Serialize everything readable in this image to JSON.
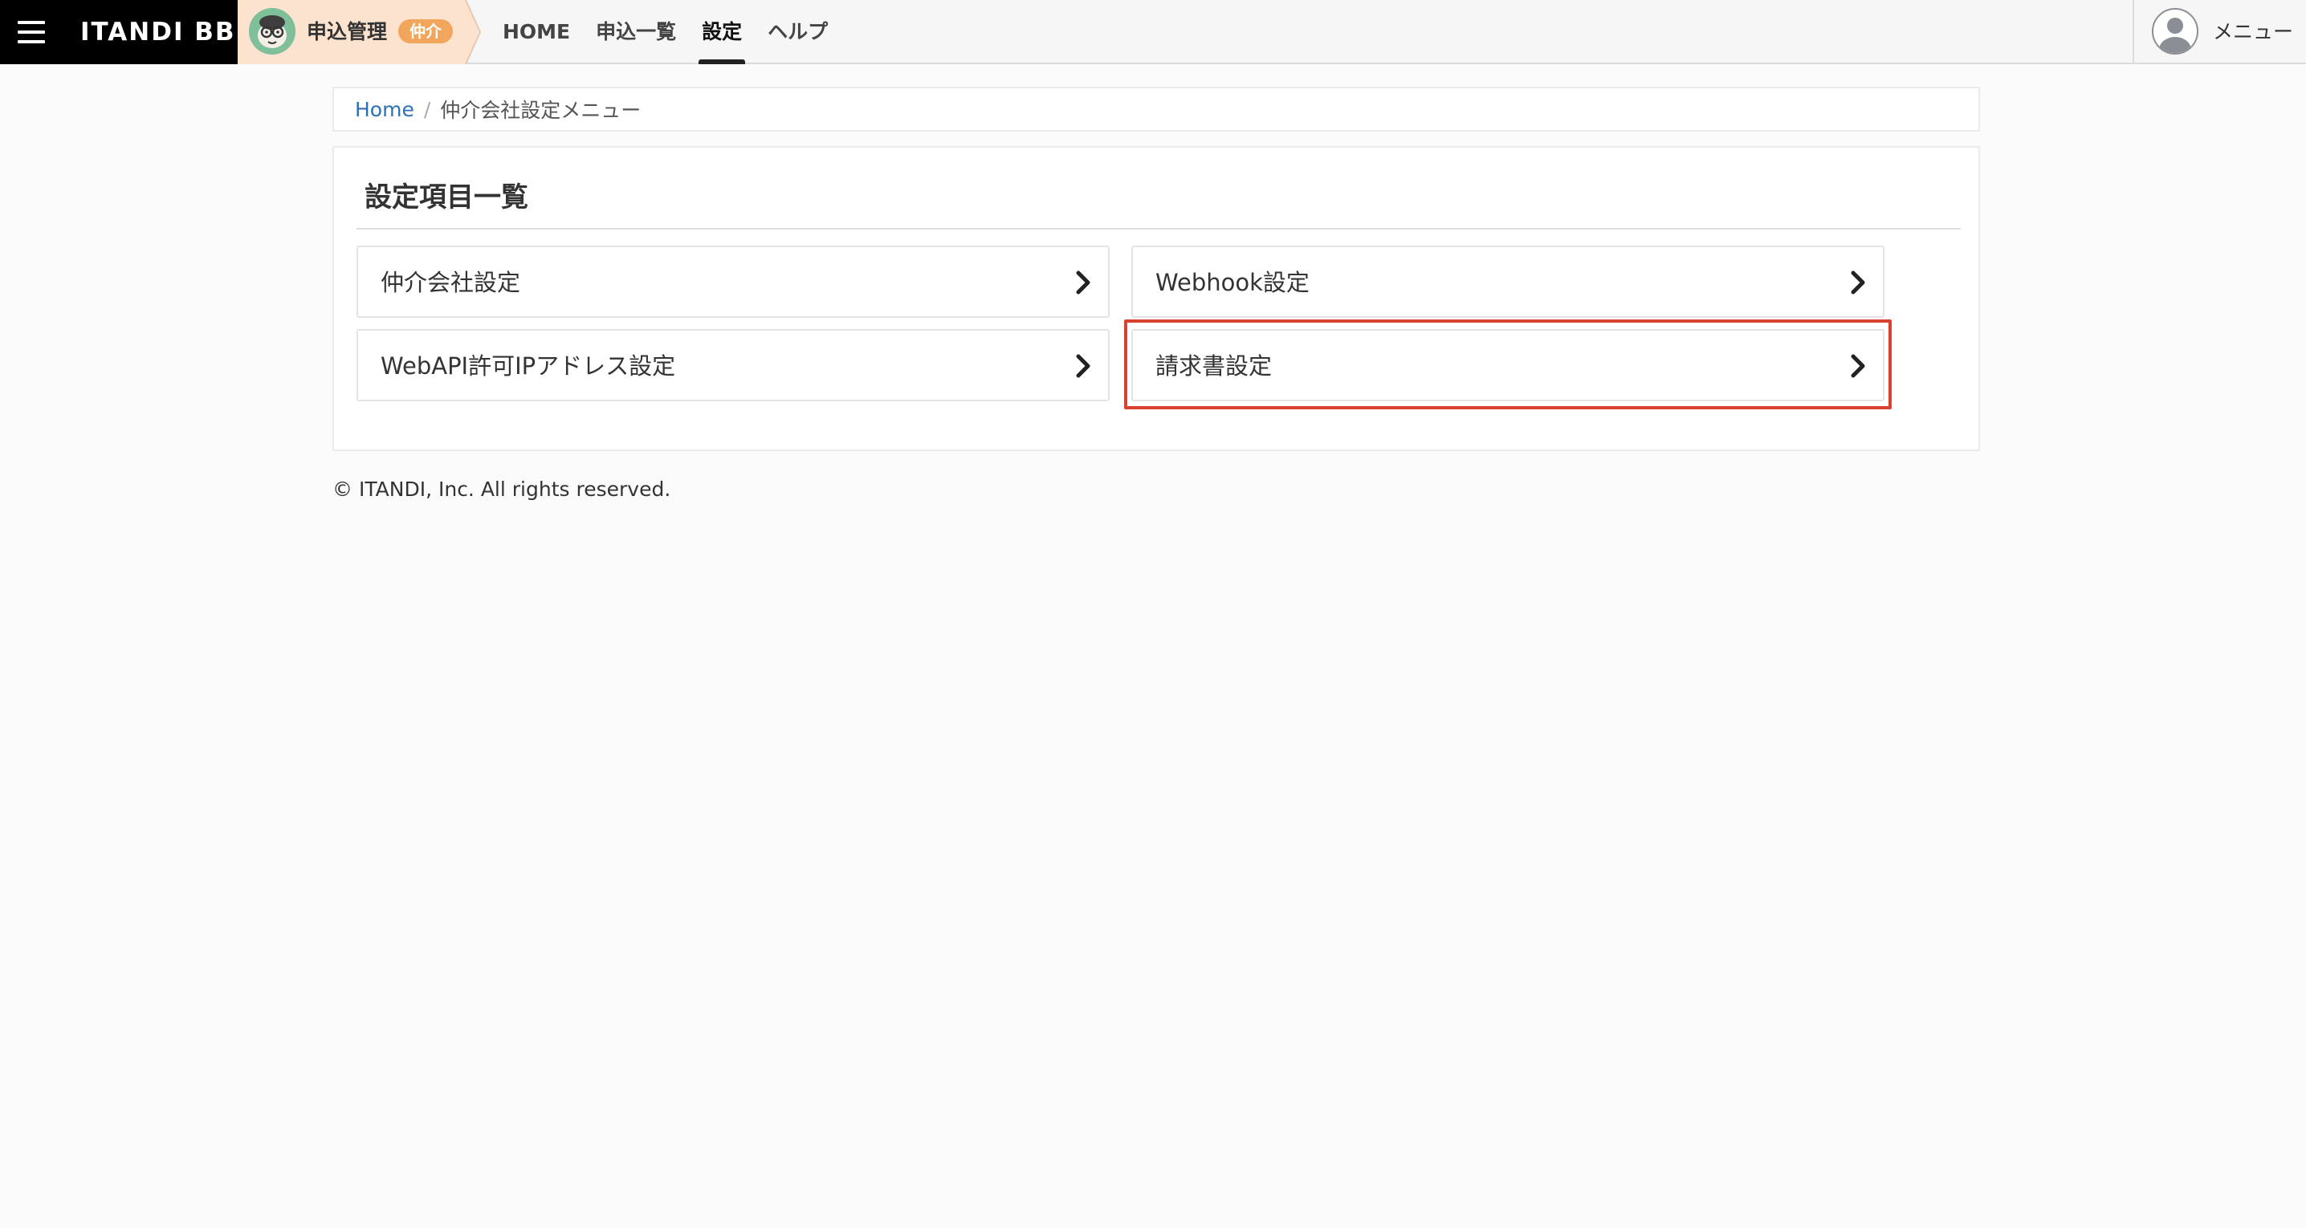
{
  "header": {
    "logo_text": "ITANDI BB",
    "app_name": "申込管理",
    "role_badge": "仲介",
    "nav": [
      {
        "label": "HOME",
        "active": false
      },
      {
        "label": "申込一覧",
        "active": false
      },
      {
        "label": "設定",
        "active": true
      },
      {
        "label": "ヘルプ",
        "active": false
      }
    ],
    "user_menu_label": "メニュー",
    "icons": [
      "hamburger-menu-icon",
      "mascot-icon",
      "user-avatar-icon"
    ]
  },
  "breadcrumb": {
    "home": "Home",
    "separator": "/",
    "current": "仲介会社設定メニュー"
  },
  "panel": {
    "title": "設定項目一覧",
    "items": [
      {
        "label": "仲介会社設定",
        "icon": "chevron-right-icon"
      },
      {
        "label": "Webhook設定",
        "icon": "chevron-right-icon"
      },
      {
        "label": "WebAPI許可IPアドレス設定",
        "icon": "chevron-right-icon"
      },
      {
        "label": "請求書設定",
        "icon": "chevron-right-icon",
        "highlighted": true
      }
    ]
  },
  "footer": {
    "copyright": "© ITANDI, Inc. All rights reserved."
  },
  "colors": {
    "header_bg": "#f6f6f6",
    "brand_bg": "#000000",
    "badge_orange": "#f2a65c",
    "app_switch_bg": "#fbe3cf",
    "link_blue": "#2d6fb5",
    "highlight_red": "#d9422f",
    "page_bg": "#fbfbfb"
  }
}
